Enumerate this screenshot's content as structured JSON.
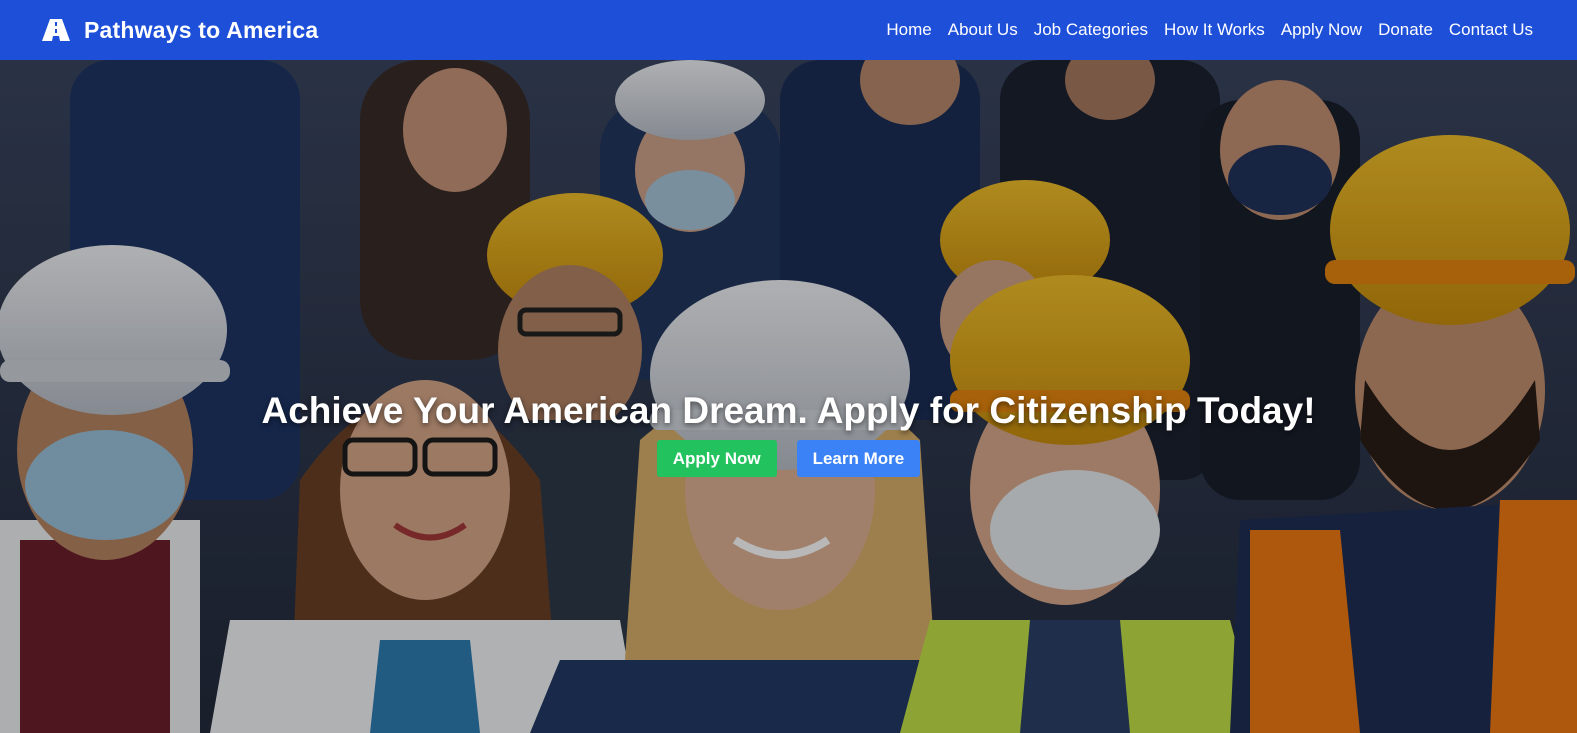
{
  "header": {
    "brand_name": "Pathways to America",
    "nav": [
      {
        "label": "Home"
      },
      {
        "label": "About Us"
      },
      {
        "label": "Job Categories"
      },
      {
        "label": "How It Works"
      },
      {
        "label": "Apply Now"
      },
      {
        "label": "Donate"
      },
      {
        "label": "Contact Us"
      }
    ]
  },
  "hero": {
    "title": "Achieve Your American Dream. Apply for Citizenship Today!",
    "primary_button": "Apply Now",
    "secondary_button": "Learn More",
    "image_subject": "group of workers in hard hats, face masks and lab coats"
  },
  "colors": {
    "nav_bg": "#1e4fd8",
    "primary_button": "#22c35e",
    "secondary_button": "#3b82f6",
    "text": "#ffffff"
  },
  "icons": [
    "road-logo-icon"
  ]
}
